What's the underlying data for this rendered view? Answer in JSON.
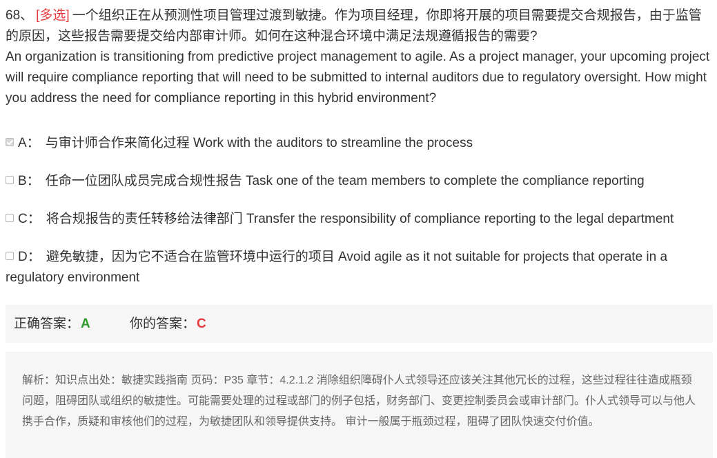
{
  "question": {
    "number": "68、",
    "tag": "[多选]",
    "text_zh": "一个组织正在从预测性项目管理过渡到敏捷。作为项目经理，你即将开展的项目需要提交合规报告，由于监管的原因，这些报告需要提交给内部审计师。如何在这种混合环境中满足法规遵循报告的需要?",
    "text_en": "An organization is transitioning from predictive project management to agile. As a project manager, your upcoming project will require compliance reporting that will need to be submitted to internal auditors due to regulatory oversight. How might you address the need for compliance reporting in this hybrid environment?"
  },
  "options": [
    {
      "letter": "A：",
      "text": "与审计师合作来简化过程 Work with the auditors to streamline the process",
      "checked": true
    },
    {
      "letter": "B：",
      "text": "任命一位团队成员完成合规性报告 Task one of the team members to complete the compliance reporting",
      "checked": false
    },
    {
      "letter": "C：",
      "text": "将合规报告的责任转移给法律部门 Transfer the responsibility of compliance reporting to the legal department",
      "checked": false
    },
    {
      "letter": "D：",
      "text": "避免敏捷，因为它不适合在监管环境中运行的项目 Avoid agile as it not suitable for projects that operate in a regulatory environment",
      "checked": false
    }
  ],
  "answer": {
    "correct_label": "正确答案：",
    "correct_value": "A",
    "yours_label": "你的答案：",
    "yours_value": "C"
  },
  "analysis": {
    "text": "解析：知识点出处：敏捷实践指南 页码：P35 章节：4.2.1.2 消除组织障碍仆人式领导还应该关注其他冗长的过程，这些过程往往造成瓶颈问题，阻碍团队或组织的敏捷性。可能需要处理的过程或部门的例子包括，财务部门、变更控制委员会或审计部门。仆人式领导可以与他人携手合作，质疑和审核他们的过程，为敏捷团队和领导提供支持。 审计一般属于瓶颈过程，阻碍了团队快速交付价值。"
  },
  "colors": {
    "tag": "#e4393c",
    "correct": "#2e9a2e",
    "wrong": "#e4393c",
    "panel_bg": "#f6f6f6"
  }
}
